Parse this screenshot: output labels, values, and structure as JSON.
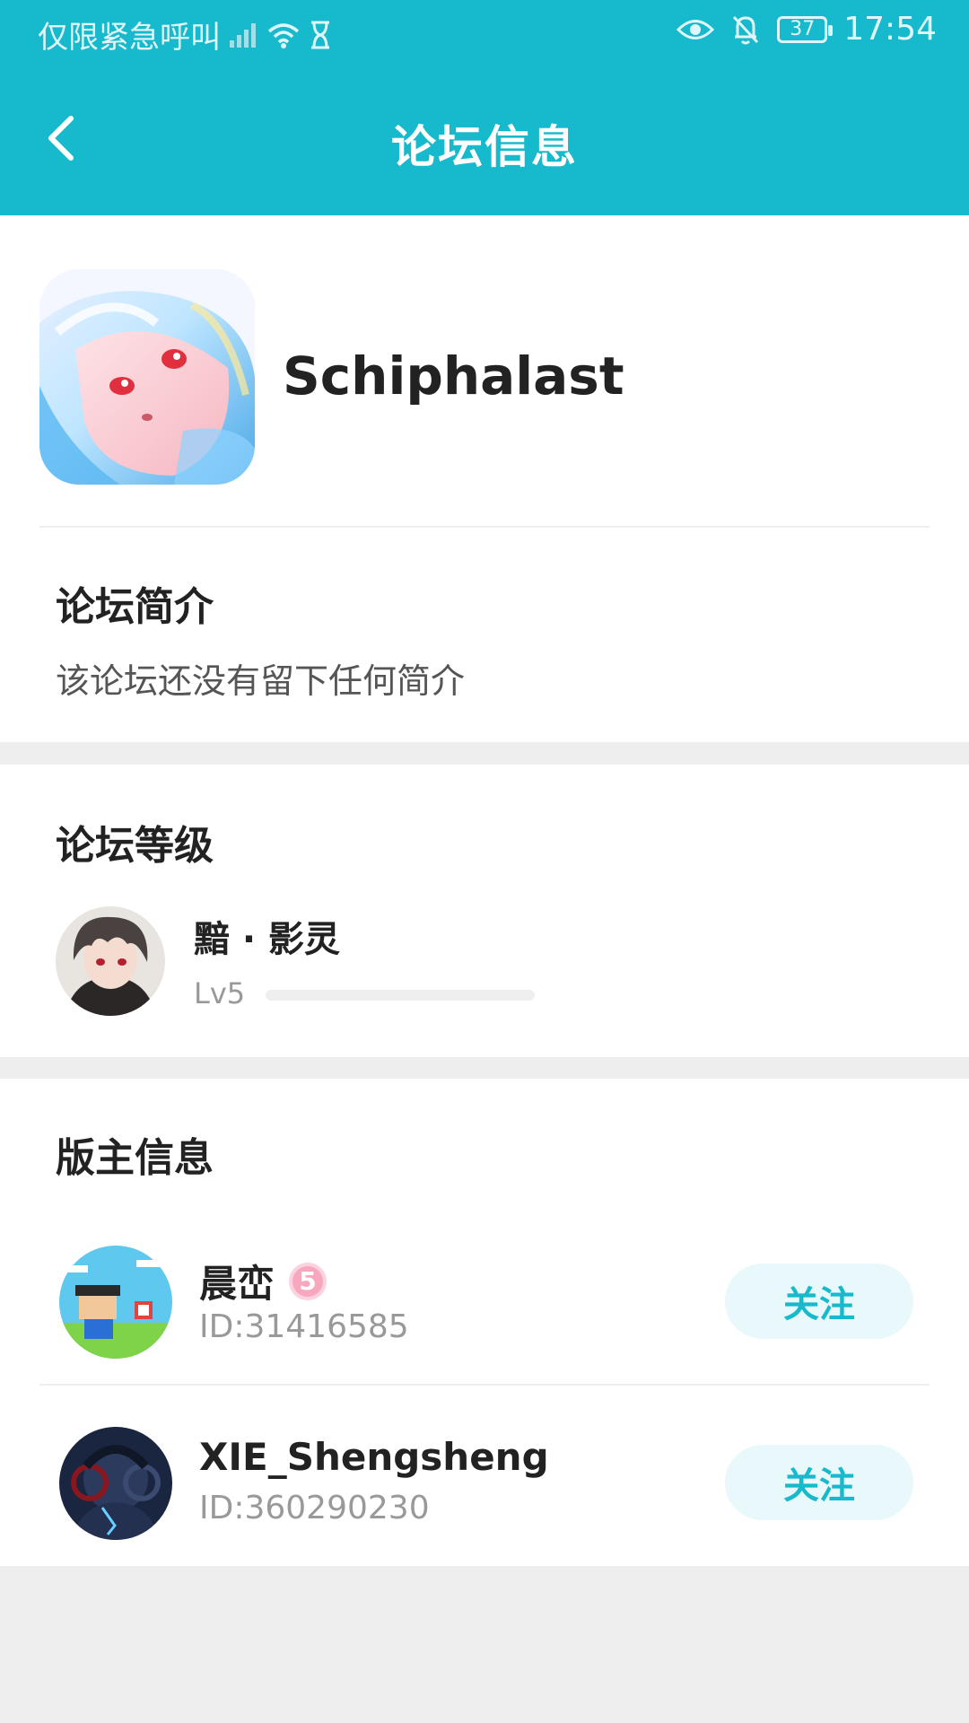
{
  "status_bar": {
    "carrier_text": "仅限紧急呼叫",
    "battery": "37",
    "time": "17:54"
  },
  "header": {
    "title": "论坛信息",
    "back_icon": "chevron-left-icon"
  },
  "forum": {
    "name": "Schiphalast"
  },
  "intro": {
    "title": "论坛简介",
    "text": "该论坛还没有留下任何简介"
  },
  "level": {
    "title": "论坛等级",
    "name": "黯 · 影灵",
    "lv": "Lv5",
    "progress": 0
  },
  "moderators": {
    "title": "版主信息",
    "items": [
      {
        "name": "晨峦",
        "badge": "5",
        "id": "ID:31416585",
        "follow": "关注"
      },
      {
        "name": "XIE_Shengsheng",
        "id": "ID:360290230",
        "follow": "关注"
      }
    ]
  },
  "colors": {
    "accent": "#17b9cc",
    "background": "#eeeeee",
    "follow_bg": "#e9f8fa"
  }
}
